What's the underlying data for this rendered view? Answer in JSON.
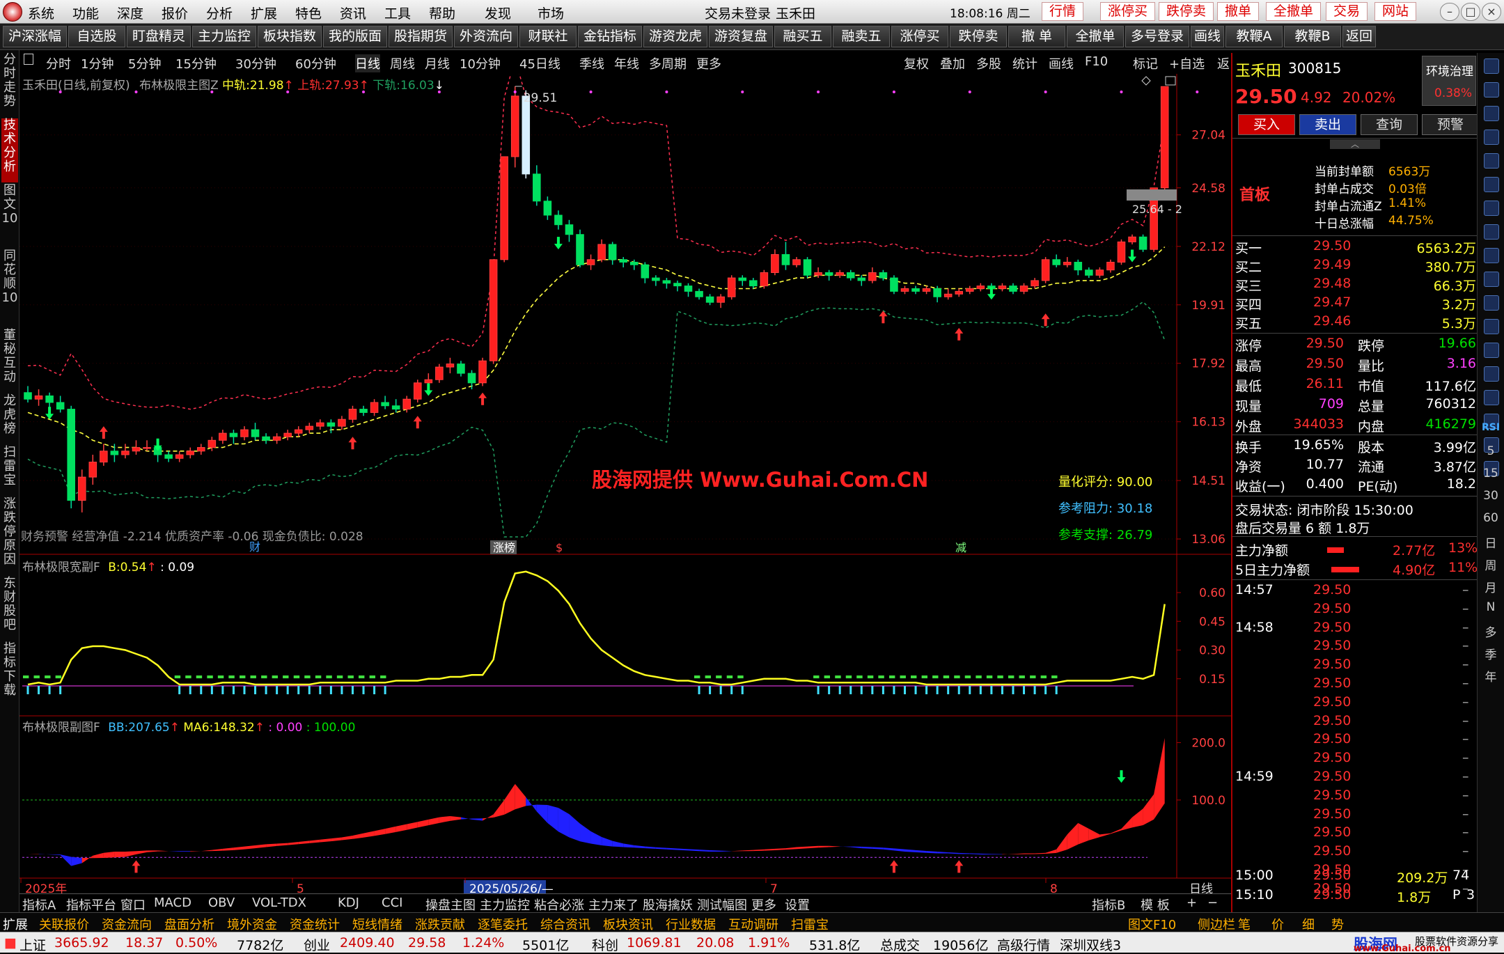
{
  "menu": {
    "items": [
      "系统",
      "功能",
      "深度",
      "报价",
      "分析",
      "扩展",
      "特色",
      "资讯",
      "工具",
      "帮助"
    ],
    "discover": "发现",
    "market": "市场",
    "login": "交易未登录",
    "stock": "玉禾田",
    "time": "18:08:16 周二",
    "right_buttons": [
      "行情",
      "涨停买",
      "跌停卖",
      "撤单",
      "全撤单",
      "交易",
      "网站"
    ]
  },
  "toolbar": [
    "沪深涨幅",
    "自选股",
    "盯盘精灵",
    "主力监控",
    "板块指数",
    "我的版面",
    "股指期货",
    "外资流向",
    "财联社",
    "金钻指标",
    "游资龙虎",
    "游资复盘",
    "融买五",
    "融卖五",
    "涨停买",
    "跌停卖",
    "撤 单",
    "全撤单",
    "多号登录",
    "画线",
    "教鞭A",
    "教鞭B",
    "返回"
  ],
  "left_tabs": [
    {
      "text": "分时走势",
      "on": false
    },
    {
      "text": "技术分析",
      "on": true
    },
    {
      "text": "图文10",
      "on": false
    },
    {
      "text": "同花顺10",
      "on": false
    },
    {
      "text": "董秘互动",
      "on": false
    },
    {
      "text": "龙虎榜",
      "on": false
    },
    {
      "text": "扫雷宝",
      "on": false
    },
    {
      "text": "涨跌停原因",
      "on": false
    },
    {
      "text": "东财股吧",
      "on": false
    },
    {
      "text": "指标下载",
      "on": false
    }
  ],
  "periods": [
    "分时",
    "1分钟",
    "5分钟",
    "15分钟",
    "30分钟",
    "60分钟",
    "日线",
    "周线",
    "月线",
    "10分钟",
    "45日线",
    "季线",
    "年线",
    "多周期",
    "更多"
  ],
  "periods_right": [
    "复权",
    "叠加",
    "多股",
    "统计",
    "画线",
    "F10",
    "标记",
    "+自选",
    "返回"
  ],
  "legend1": {
    "name": "玉禾田(日线,前复权)",
    "ind": "布林极限主图Z",
    "mid_label": "中轨:",
    "mid": "21.98",
    "up_label": "上轨:",
    "up": "27.93",
    "dn_label": "下轨:",
    "dn": "16.03"
  },
  "legend2": {
    "name": "布林极限宽副F",
    "b_label": "B:",
    "b": "0.54",
    "v2": ": 0.09"
  },
  "legend3": {
    "name": "布林极限副图F",
    "bb_label": "BB:",
    "bb": "207.65",
    "ma_label": "MA6:",
    "ma": "148.32",
    "v3": ": 0.00",
    "v4": ": 100.00"
  },
  "fin": "财务预警  经营净值 -2.214  优质资产率 -0.06  现金负债比: 0.028",
  "watermark": "股海网提供 Www.Guhai.Com.CN",
  "score": {
    "l1": "量化评分:",
    "v1": "90.00",
    "l2": "参考阻力:",
    "v2": "30.18",
    "l3": "参考支撑:",
    "v3": "26.79"
  },
  "marks": {
    "cai": "财",
    "zhangbang": "涨榜",
    "jian": "减",
    "s": "$",
    "peak": "29.51",
    "lastlab": "25.64 - 2"
  },
  "yaxis_main": [
    "27.04",
    "24.58",
    "22.12",
    "19.91",
    "17.92",
    "16.13",
    "14.51",
    "13.06"
  ],
  "yaxis_sub2": [
    "0.60",
    "0.45",
    "0.30",
    "0.15"
  ],
  "yaxis_sub3": [
    "200.0",
    "100.0"
  ],
  "xaxis": [
    "2025年",
    "5",
    "2025/05/26/—",
    "7",
    "8"
  ],
  "xright": "日线",
  "bottom_tabs": [
    "指标A",
    "指标平台",
    "窗口",
    "MACD",
    "OBV",
    "VOL-TDX",
    "KDJ",
    "CCI",
    "操盘主图",
    "主力监控",
    "粘合必涨",
    "主力来了",
    "股海擒妖",
    "测试幅图",
    "更多",
    "设置"
  ],
  "bottom_right": [
    "指标B",
    "模 板",
    "+",
    "−"
  ],
  "status2": [
    "扩展",
    "关联报价",
    "资金流向",
    "盘面分析",
    "境外资金",
    "资金统计",
    "短线情绪",
    "涨跌贡献",
    "逐笔委托",
    "综合资讯",
    "板块资讯",
    "行业数据",
    "互动调研",
    "扫雷宝"
  ],
  "status2_right": [
    "图文F10",
    "侧边栏",
    "笔",
    "价",
    "细",
    "势"
  ],
  "status3": {
    "sh": "上证",
    "sh_v": "3665.92",
    "sh_c": "18.37",
    "sh_p": "0.50%",
    "sh_a": "7782亿",
    "cy": "创业",
    "cy_v": "2409.40",
    "cy_c": "29.58",
    "cy_p": "1.24%",
    "cy_a": "5501亿",
    "kc": "科创",
    "kc_v": "1069.81",
    "kc_c": "20.08",
    "kc_p": "1.91%",
    "kc_a": "531.8亿",
    "tot": "总成交",
    "tot_v": "19056亿",
    "adv": "高级行情",
    "line": "深圳双线3",
    "brand": "股海网",
    "brand2": "股票软件资源分享",
    "url": "www.Guhai.com.cn"
  },
  "quote": {
    "name": "玉禾田",
    "code": "300815",
    "env": "环境治理",
    "env_p": "0.38%",
    "price": "29.50",
    "chg": "4.92",
    "pct": "20.02%",
    "btn": [
      "买入",
      "卖出",
      "查询",
      "预警"
    ],
    "tag": "首板",
    "seal": [
      [
        "当前封单额",
        "6563万"
      ],
      [
        "封单占成交",
        "0.03倍"
      ],
      [
        "封单占流通Z",
        "1.41%"
      ],
      [
        "十日总涨幅",
        "44.75%"
      ]
    ],
    "bids": [
      [
        "买一",
        "29.50",
        "6563.2万"
      ],
      [
        "买二",
        "29.49",
        "380.7万"
      ],
      [
        "买三",
        "29.48",
        "66.3万"
      ],
      [
        "买四",
        "29.47",
        "3.2万"
      ],
      [
        "买五",
        "29.46",
        "5.3万"
      ]
    ],
    "stats": [
      [
        "涨停",
        "29.50",
        "跌停",
        "19.66"
      ],
      [
        "最高",
        "29.50",
        "量比",
        "3.16"
      ],
      [
        "最低",
        "26.11",
        "市值",
        "117.6亿"
      ],
      [
        "现量",
        "709",
        "总量",
        "760312"
      ],
      [
        "外盘",
        "344033",
        "内盘",
        "416279"
      ]
    ],
    "stats2": [
      [
        "换手",
        "19.65%",
        "股本",
        "3.99亿"
      ],
      [
        "净资",
        "10.77",
        "流通",
        "3.87亿"
      ],
      [
        "收益(一)",
        "0.400",
        "PE(动)",
        "18.2"
      ]
    ],
    "state": "交易状态: 闭市阶段 15:30:00",
    "after": "盘后交易量 6 额 1.8万",
    "flow": [
      [
        "主力净额",
        "2.77亿",
        "13%"
      ],
      [
        "5日主力净额",
        "4.90亿",
        "11%"
      ]
    ],
    "ticks": [
      [
        "14:57",
        "29.50"
      ],
      [
        "",
        "29.50"
      ],
      [
        "14:58",
        "29.50"
      ],
      [
        "",
        "29.50"
      ],
      [
        "",
        "29.50"
      ],
      [
        "",
        "29.50"
      ],
      [
        "",
        "29.50"
      ],
      [
        "",
        "29.50"
      ],
      [
        "",
        "29.50"
      ],
      [
        "",
        "29.50"
      ],
      [
        "14:59",
        "29.50"
      ],
      [
        "",
        "29.50"
      ],
      [
        "",
        "29.50"
      ],
      [
        "",
        "29.50"
      ],
      [
        "",
        "29.50"
      ],
      [
        "",
        "29.50"
      ],
      [
        "",
        "29.50"
      ],
      [
        "15:00",
        "29.50",
        "209.2万",
        "74"
      ],
      [
        "15:10",
        "29.50",
        "1.8万",
        "P",
        "3"
      ]
    ]
  },
  "right_rail": [
    "RSI",
    "5",
    "15",
    "30",
    "60",
    "日",
    "周",
    "月",
    "N",
    "多",
    "季",
    "年"
  ],
  "chart_data": {
    "type": "candlestick",
    "colors": {
      "up": "#ff2020",
      "down": "#00e0ff",
      "mid": "#ffff40",
      "band": "#ff3050",
      "lower": "#20a060"
    },
    "candles": [
      [
        17.0,
        16.8,
        17.2,
        16.7
      ],
      [
        16.8,
        16.9,
        17.1,
        16.6
      ],
      [
        16.9,
        16.7,
        17.0,
        16.5
      ],
      [
        16.7,
        16.5,
        16.9,
        16.4
      ],
      [
        16.5,
        14.0,
        16.6,
        13.8
      ],
      [
        14.0,
        14.6,
        14.8,
        13.7
      ],
      [
        14.6,
        15.0,
        15.2,
        14.4
      ],
      [
        15.0,
        15.3,
        15.5,
        14.9
      ],
      [
        15.3,
        15.2,
        15.5,
        15.0
      ],
      [
        15.2,
        15.3,
        15.5,
        15.1
      ],
      [
        15.3,
        15.4,
        15.6,
        15.2
      ],
      [
        15.4,
        15.4,
        15.6,
        15.3
      ],
      [
        15.4,
        15.2,
        15.5,
        15.0
      ],
      [
        15.2,
        15.1,
        15.3,
        15.0
      ],
      [
        15.1,
        15.2,
        15.3,
        15.0
      ],
      [
        15.2,
        15.3,
        15.4,
        15.1
      ],
      [
        15.3,
        15.4,
        15.5,
        15.2
      ],
      [
        15.4,
        15.6,
        15.7,
        15.3
      ],
      [
        15.6,
        15.8,
        15.9,
        15.5
      ],
      [
        15.8,
        15.7,
        15.9,
        15.5
      ],
      [
        15.7,
        15.9,
        16.0,
        15.6
      ],
      [
        15.9,
        15.7,
        16.1,
        15.6
      ],
      [
        15.7,
        15.6,
        15.8,
        15.5
      ],
      [
        15.6,
        15.7,
        15.8,
        15.5
      ],
      [
        15.7,
        15.8,
        15.9,
        15.6
      ],
      [
        15.8,
        15.9,
        16.0,
        15.7
      ],
      [
        15.9,
        16.0,
        16.1,
        15.8
      ],
      [
        16.0,
        16.1,
        16.2,
        15.9
      ],
      [
        16.1,
        16.0,
        16.2,
        15.8
      ],
      [
        16.0,
        16.2,
        16.3,
        15.9
      ],
      [
        16.2,
        16.5,
        16.6,
        16.1
      ],
      [
        16.5,
        16.4,
        16.6,
        16.3
      ],
      [
        16.4,
        16.7,
        16.8,
        16.3
      ],
      [
        16.7,
        16.6,
        16.9,
        16.5
      ],
      [
        16.6,
        16.5,
        16.8,
        16.4
      ],
      [
        16.5,
        16.8,
        16.9,
        16.4
      ],
      [
        16.8,
        17.3,
        17.4,
        16.7
      ],
      [
        17.3,
        17.4,
        17.6,
        17.2
      ],
      [
        17.4,
        17.8,
        17.9,
        17.3
      ],
      [
        17.8,
        17.9,
        18.1,
        17.6
      ],
      [
        17.9,
        17.6,
        18.0,
        17.5
      ],
      [
        17.6,
        17.3,
        17.7,
        17.1
      ],
      [
        17.3,
        18.0,
        18.1,
        17.2
      ],
      [
        18.0,
        21.6,
        21.6,
        17.9
      ],
      [
        21.6,
        26.0,
        26.0,
        21.5
      ],
      [
        26.0,
        29.0,
        29.51,
        25.5
      ],
      [
        29.0,
        25.2,
        29.3,
        25.0
      ],
      [
        25.2,
        24.0,
        25.6,
        23.8
      ],
      [
        24.0,
        23.4,
        24.2,
        23.2
      ],
      [
        23.4,
        23.0,
        23.6,
        22.8
      ],
      [
        23.0,
        22.6,
        23.2,
        22.3
      ],
      [
        22.6,
        21.4,
        22.8,
        21.3
      ],
      [
        21.4,
        21.6,
        21.8,
        21.2
      ],
      [
        21.6,
        22.2,
        22.4,
        21.5
      ],
      [
        22.2,
        21.6,
        22.3,
        21.4
      ],
      [
        21.6,
        21.5,
        21.7,
        21.3
      ],
      [
        21.5,
        21.4,
        21.6,
        21.2
      ],
      [
        21.4,
        20.9,
        21.5,
        20.7
      ],
      [
        20.9,
        20.8,
        21.0,
        20.6
      ],
      [
        20.8,
        20.7,
        20.9,
        20.5
      ],
      [
        20.7,
        20.6,
        20.8,
        20.4
      ],
      [
        20.6,
        20.4,
        20.7,
        20.2
      ],
      [
        20.4,
        20.2,
        20.5,
        20.1
      ],
      [
        20.2,
        20.0,
        20.3,
        19.9
      ],
      [
        20.0,
        20.2,
        20.3,
        19.8
      ],
      [
        20.2,
        20.9,
        21.0,
        20.1
      ],
      [
        20.9,
        20.8,
        21.0,
        20.6
      ],
      [
        20.8,
        20.6,
        20.9,
        20.5
      ],
      [
        20.6,
        21.1,
        21.2,
        20.5
      ],
      [
        21.1,
        21.8,
        22.0,
        21.0
      ],
      [
        21.8,
        21.4,
        22.3,
        21.2
      ],
      [
        21.4,
        21.6,
        21.7,
        21.3
      ],
      [
        21.6,
        21.0,
        21.7,
        20.9
      ],
      [
        21.0,
        21.1,
        21.3,
        20.9
      ],
      [
        21.1,
        21.0,
        21.2,
        20.8
      ],
      [
        21.0,
        21.1,
        21.2,
        20.9
      ],
      [
        21.1,
        20.9,
        21.2,
        20.8
      ],
      [
        20.9,
        20.8,
        21.0,
        20.6
      ],
      [
        20.8,
        21.1,
        21.3,
        20.7
      ],
      [
        21.1,
        20.9,
        21.2,
        20.8
      ],
      [
        20.9,
        20.4,
        21.0,
        20.3
      ],
      [
        20.4,
        20.5,
        20.6,
        20.3
      ],
      [
        20.5,
        20.4,
        20.6,
        20.3
      ],
      [
        20.4,
        20.5,
        20.6,
        20.3
      ],
      [
        20.5,
        20.2,
        20.6,
        20.0
      ],
      [
        20.2,
        20.3,
        20.5,
        20.1
      ],
      [
        20.3,
        20.4,
        20.5,
        20.2
      ],
      [
        20.4,
        20.5,
        20.6,
        20.3
      ],
      [
        20.5,
        20.6,
        20.7,
        20.4
      ],
      [
        20.6,
        20.5,
        20.7,
        20.4
      ],
      [
        20.5,
        20.6,
        20.7,
        20.4
      ],
      [
        20.6,
        20.4,
        20.7,
        20.3
      ],
      [
        20.4,
        20.6,
        20.7,
        20.3
      ],
      [
        20.6,
        20.8,
        20.9,
        20.5
      ],
      [
        20.8,
        21.6,
        21.7,
        20.7
      ],
      [
        21.6,
        21.4,
        21.8,
        21.3
      ],
      [
        21.4,
        21.5,
        21.7,
        21.3
      ],
      [
        21.5,
        21.2,
        21.6,
        21.0
      ],
      [
        21.2,
        21.0,
        21.3,
        20.9
      ],
      [
        21.0,
        21.2,
        21.3,
        20.9
      ],
      [
        21.2,
        21.5,
        21.6,
        21.1
      ],
      [
        21.5,
        22.3,
        22.4,
        21.4
      ],
      [
        22.3,
        22.5,
        22.6,
        22.2
      ],
      [
        22.5,
        22.0,
        22.6,
        21.9
      ],
      [
        22.0,
        24.58,
        24.58,
        21.9
      ],
      [
        24.58,
        29.5,
        29.5,
        24.5
      ]
    ],
    "mid": [
      16.4,
      16.3,
      16.2,
      16.1,
      15.9,
      15.8,
      15.6,
      15.5,
      15.4,
      15.4,
      15.4,
      15.3,
      15.3,
      15.3,
      15.3,
      15.3,
      15.3,
      15.4,
      15.4,
      15.5,
      15.5,
      15.6,
      15.6,
      15.6,
      15.7,
      15.7,
      15.8,
      15.8,
      15.9,
      15.9,
      16.0,
      16.1,
      16.2,
      16.3,
      16.4,
      16.5,
      16.6,
      16.7,
      16.9,
      17.0,
      17.1,
      17.2,
      17.3,
      17.7,
      18.3,
      19.0,
      19.6,
      20.1,
      20.5,
      20.9,
      21.2,
      21.4,
      21.5,
      21.6,
      21.6,
      21.6,
      21.5,
      21.4,
      21.3,
      21.2,
      21.0,
      20.9,
      20.7,
      20.6,
      20.5,
      20.5,
      20.5,
      20.5,
      20.6,
      20.7,
      20.8,
      20.9,
      20.9,
      21.0,
      21.0,
      21.0,
      21.0,
      21.0,
      21.0,
      20.9,
      20.8,
      20.7,
      20.7,
      20.6,
      20.5,
      20.5,
      20.5,
      20.5,
      20.5,
      20.5,
      20.5,
      20.5,
      20.5,
      20.5,
      20.6,
      20.7,
      20.7,
      20.8,
      20.8,
      20.8,
      20.9,
      21.1,
      21.3,
      21.4,
      21.7,
      22.1
    ],
    "sub2": [
      0.12,
      0.13,
      0.12,
      0.13,
      0.25,
      0.31,
      0.32,
      0.32,
      0.31,
      0.3,
      0.28,
      0.26,
      0.22,
      0.16,
      0.12,
      0.12,
      0.12,
      0.12,
      0.13,
      0.13,
      0.13,
      0.12,
      0.12,
      0.12,
      0.12,
      0.12,
      0.12,
      0.13,
      0.13,
      0.13,
      0.13,
      0.13,
      0.13,
      0.13,
      0.14,
      0.14,
      0.14,
      0.15,
      0.15,
      0.16,
      0.16,
      0.17,
      0.17,
      0.25,
      0.55,
      0.7,
      0.71,
      0.69,
      0.66,
      0.61,
      0.54,
      0.44,
      0.36,
      0.3,
      0.26,
      0.22,
      0.19,
      0.17,
      0.16,
      0.15,
      0.14,
      0.14,
      0.13,
      0.13,
      0.12,
      0.12,
      0.13,
      0.14,
      0.15,
      0.15,
      0.15,
      0.14,
      0.14,
      0.13,
      0.13,
      0.13,
      0.13,
      0.13,
      0.13,
      0.13,
      0.13,
      0.13,
      0.13,
      0.12,
      0.12,
      0.12,
      0.12,
      0.12,
      0.12,
      0.12,
      0.12,
      0.12,
      0.12,
      0.12,
      0.12,
      0.13,
      0.14,
      0.14,
      0.14,
      0.14,
      0.14,
      0.15,
      0.16,
      0.15,
      0.17,
      0.54
    ],
    "sub3": [
      5,
      6,
      5,
      4,
      -15,
      -10,
      3,
      8,
      10,
      10,
      11,
      12,
      12,
      11,
      10,
      10,
      11,
      13,
      15,
      17,
      19,
      21,
      23,
      24,
      25,
      27,
      29,
      31,
      33,
      35,
      38,
      42,
      46,
      50,
      54,
      58,
      62,
      66,
      70,
      72,
      70,
      66,
      64,
      75,
      100,
      128,
      105,
      80,
      60,
      45,
      35,
      28,
      24,
      21,
      19,
      18,
      17,
      16,
      15,
      14,
      13,
      12,
      11,
      10,
      10,
      11,
      12,
      13,
      14,
      15,
      16,
      18,
      19,
      20,
      20,
      19,
      18,
      16,
      15,
      14,
      12,
      10,
      9,
      8,
      7,
      7,
      6,
      6,
      5,
      5,
      5,
      6,
      7,
      7,
      8,
      14,
      40,
      60,
      50,
      40,
      42,
      50,
      70,
      85,
      110,
      208
    ],
    "x_range": [
      0,
      105
    ],
    "ylim_main": [
      13.06,
      29.51
    ],
    "ylim_sub2": [
      0,
      0.72
    ],
    "ylim_sub3": [
      -30,
      220
    ]
  }
}
